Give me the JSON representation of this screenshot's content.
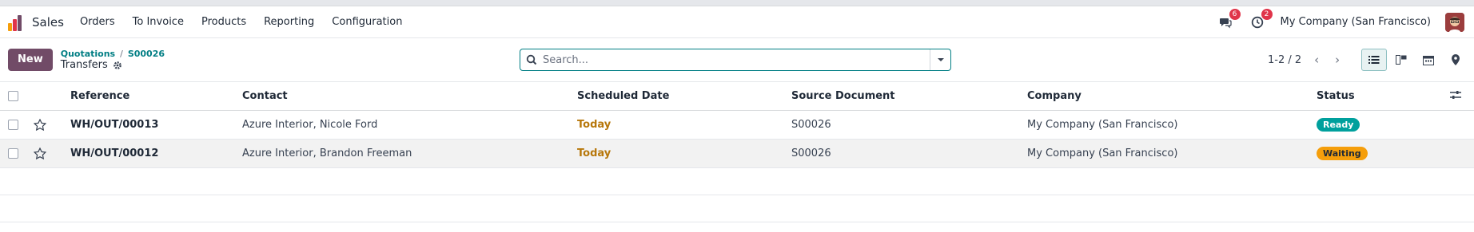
{
  "navbar": {
    "app_name": "Sales",
    "menu": [
      "Orders",
      "To Invoice",
      "Products",
      "Reporting",
      "Configuration"
    ],
    "messages_count": "6",
    "activities_count": "2",
    "company": "My Company (San Francisco)"
  },
  "control": {
    "new_label": "New",
    "breadcrumb": [
      "Quotations",
      "S00026"
    ],
    "breadcrumb_sep": "/",
    "title": "Transfers",
    "search_placeholder": "Search...",
    "pager": "1-2 / 2"
  },
  "table": {
    "columns": [
      "Reference",
      "Contact",
      "Scheduled Date",
      "Source Document",
      "Company",
      "Status"
    ],
    "rows": [
      {
        "reference": "WH/OUT/00013",
        "contact": "Azure Interior, Nicole Ford",
        "date": "Today",
        "source": "S00026",
        "company": "My Company (San Francisco)",
        "status": "Ready"
      },
      {
        "reference": "WH/OUT/00012",
        "contact": "Azure Interior, Brandon Freeman",
        "date": "Today",
        "source": "S00026",
        "company": "My Company (San Francisco)",
        "status": "Waiting"
      }
    ]
  },
  "colors": {
    "brand": "#714b67",
    "accent": "#017e84",
    "ready": "#00a09d",
    "waiting": "#f59e0b",
    "date": "#b7770a",
    "badge": "#e0344a"
  }
}
